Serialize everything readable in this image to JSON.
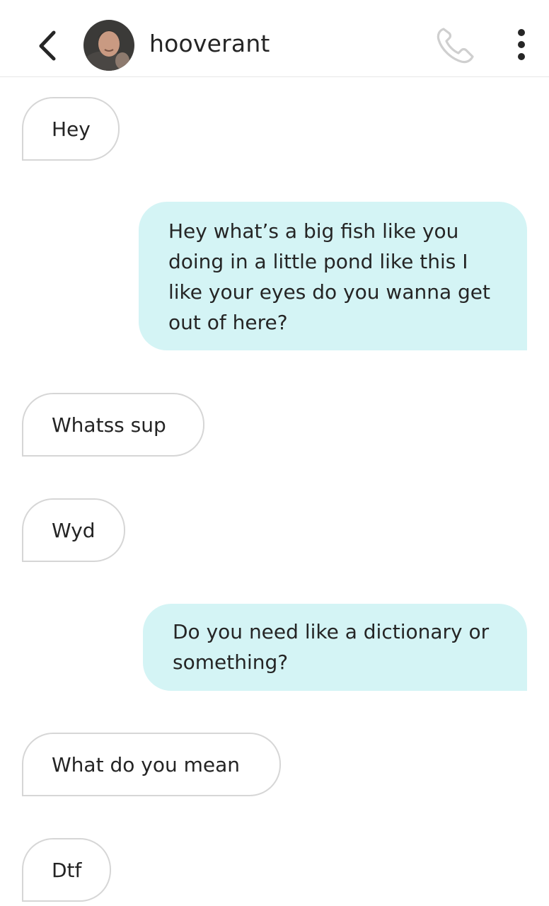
{
  "header": {
    "contact_name": "hooverant",
    "back_icon": "chevron-left-icon",
    "call_icon": "phone-icon",
    "more_icon": "more-vertical-icon"
  },
  "colors": {
    "outgoing_bubble": "#d4f4f5",
    "incoming_border": "#d6d6d6",
    "icon_gray": "#cfcfcf"
  },
  "messages": [
    {
      "direction": "incoming",
      "lines": [
        "Hey"
      ]
    },
    {
      "direction": "outgoing",
      "lines": [
        "Hey what’s a big fish like you",
        "doing in a little pond like this I",
        "like your eyes do you wanna get",
        "out of here?"
      ]
    },
    {
      "direction": "incoming",
      "lines": [
        "Whatss sup"
      ]
    },
    {
      "direction": "incoming",
      "lines": [
        "Wyd"
      ]
    },
    {
      "direction": "outgoing",
      "lines": [
        "Do you need like a dictionary or",
        "something?"
      ]
    },
    {
      "direction": "incoming",
      "lines": [
        "What do you mean"
      ]
    },
    {
      "direction": "incoming",
      "lines": [
        "Dtf"
      ]
    }
  ]
}
